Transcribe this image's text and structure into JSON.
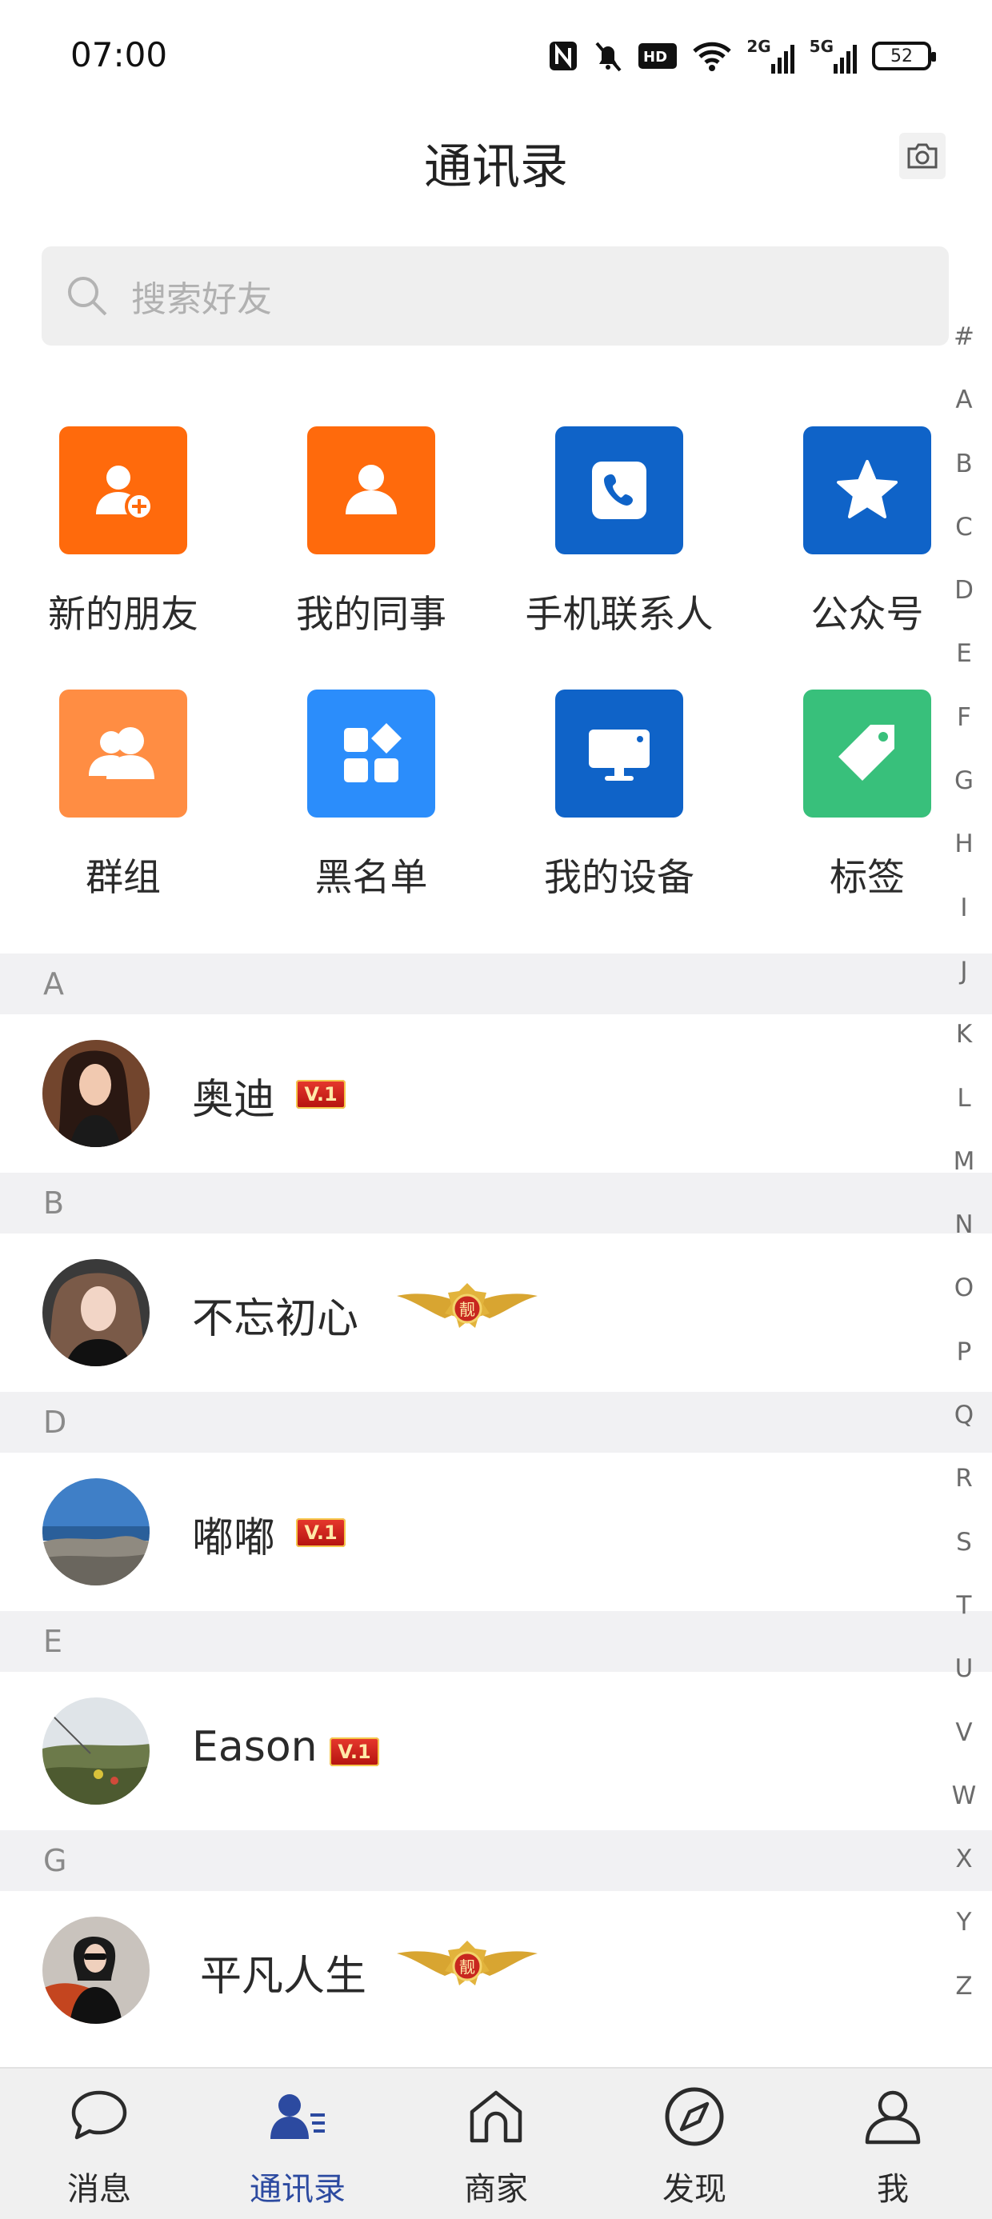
{
  "status_bar": {
    "time": "07:00",
    "battery": "52",
    "net1": "2G",
    "net2": "5G"
  },
  "header": {
    "title": "通讯录"
  },
  "search": {
    "placeholder": "搜索好友"
  },
  "grid": [
    {
      "label": "新的朋友",
      "icon": "add-friend-icon",
      "color": "#ff6a0c"
    },
    {
      "label": "我的同事",
      "icon": "colleague-icon",
      "color": "#ff6a0c"
    },
    {
      "label": "手机联系人",
      "icon": "phone-contacts-icon",
      "color": "#0f63c8"
    },
    {
      "label": "公众号",
      "icon": "star-icon",
      "color": "#0f63c8"
    },
    {
      "label": "群组",
      "icon": "group-icon",
      "color": "#ff8d43"
    },
    {
      "label": "黑名单",
      "icon": "apps-icon",
      "color": "#2b8dfb"
    },
    {
      "label": "我的设备",
      "icon": "monitor-icon",
      "color": "#0f63c8"
    },
    {
      "label": "标签",
      "icon": "tag-icon",
      "color": "#38c07b"
    }
  ],
  "index": [
    "#",
    "A",
    "B",
    "C",
    "D",
    "E",
    "F",
    "G",
    "H",
    "I",
    "J",
    "K",
    "L",
    "M",
    "N",
    "O",
    "P",
    "Q",
    "R",
    "S",
    "T",
    "U",
    "V",
    "W",
    "X",
    "Y",
    "Z"
  ],
  "sections": [
    {
      "letter": "A",
      "contact": {
        "name": "奥迪",
        "badge": "V.1"
      }
    },
    {
      "letter": "B",
      "contact": {
        "name": "不忘初心",
        "badge": "靓"
      }
    },
    {
      "letter": "D",
      "contact": {
        "name": "嘟嘟",
        "badge": "V.1"
      }
    },
    {
      "letter": "E",
      "contact": {
        "name": "Eason",
        "badge": "V.1"
      }
    },
    {
      "letter": "G",
      "contact": {
        "name": "平凡人生",
        "badge": "靓"
      }
    }
  ],
  "tabs": [
    {
      "label": "消息",
      "icon": "message-icon"
    },
    {
      "label": "通讯录",
      "icon": "contacts-icon",
      "active": true
    },
    {
      "label": "商家",
      "icon": "store-icon"
    },
    {
      "label": "发现",
      "icon": "compass-icon"
    },
    {
      "label": "我",
      "icon": "profile-icon"
    }
  ],
  "colors": {
    "accent": "#2c4aa0",
    "section_bg": "#f1f1f3",
    "badge_red": "#d3221a"
  }
}
